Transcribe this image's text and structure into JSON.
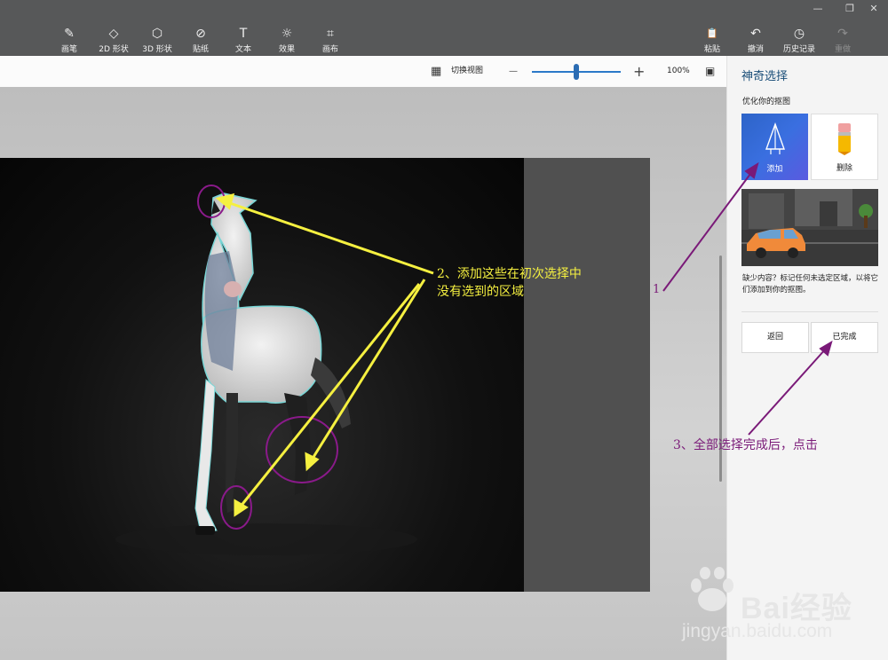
{
  "toolbar": {
    "tools": [
      {
        "label": "画笔",
        "icon": "brush-icon",
        "glyph": "✎"
      },
      {
        "label": "2D 形状",
        "icon": "shapes-2d-icon",
        "glyph": "◇"
      },
      {
        "label": "3D 形状",
        "icon": "cube-3d-icon",
        "glyph": "⬡"
      },
      {
        "label": "贴纸",
        "icon": "sticker-icon",
        "glyph": "⊘"
      },
      {
        "label": "文本",
        "icon": "text-icon",
        "glyph": "T"
      },
      {
        "label": "效果",
        "icon": "effects-icon",
        "glyph": "☼"
      },
      {
        "label": "画布",
        "icon": "canvas-icon",
        "glyph": "⌗"
      }
    ],
    "actions": [
      {
        "label": "粘贴",
        "icon": "paste-icon",
        "glyph": "📋"
      },
      {
        "label": "撤消",
        "icon": "undo-icon",
        "glyph": "↶"
      },
      {
        "label": "历史记录",
        "icon": "history-icon",
        "glyph": "◷"
      },
      {
        "label": "重做",
        "icon": "redo-icon",
        "glyph": "↷"
      }
    ]
  },
  "subbar": {
    "view_toggle": "切换视图",
    "zoom_minus": "—",
    "zoom_plus": "+",
    "zoom_level": "100%"
  },
  "panel": {
    "title": "神奇选择",
    "subtitle": "优化你的抠图",
    "add_label": "添加",
    "remove_label": "删除",
    "description": "缺少内容？标记任何未选定区域，以将它们添加到你的抠图。",
    "back_button": "返回",
    "done_button": "已完成"
  },
  "annotations": {
    "label_1": "1",
    "label_2_line1": "2、添加这些在初次选择中",
    "label_2_line2": "没有选到的区域",
    "label_3": "3、全部选择完成后，点击"
  },
  "colors": {
    "annotation_yellow": "#f5f040",
    "annotation_purple": "#7a1a78",
    "accent_blue": "#2d64c8"
  },
  "watermark": {
    "brand": "Bai经验",
    "url": "jingyan.baidu.com"
  }
}
